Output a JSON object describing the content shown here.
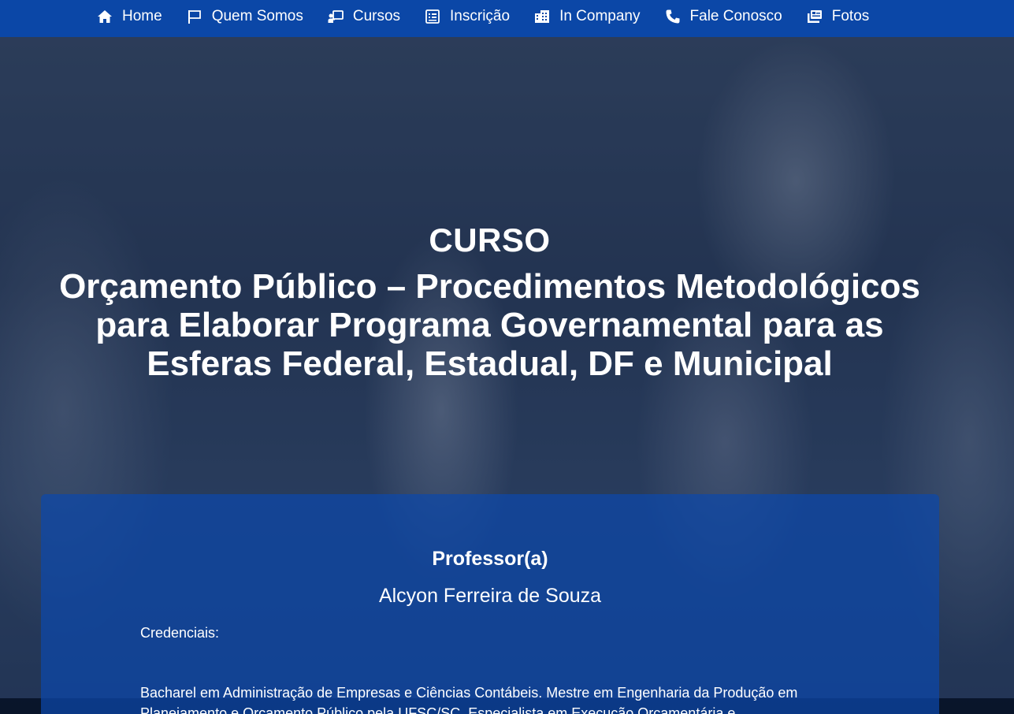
{
  "nav": {
    "items": [
      {
        "label": "Home",
        "icon": "home-icon"
      },
      {
        "label": "Quem Somos",
        "icon": "flag-icon"
      },
      {
        "label": "Cursos",
        "icon": "teacher-board-icon"
      },
      {
        "label": "Inscrição",
        "icon": "form-list-icon"
      },
      {
        "label": "In Company",
        "icon": "building-icon"
      },
      {
        "label": "Fale Conosco",
        "icon": "phone-icon"
      },
      {
        "label": "Fotos",
        "icon": "photos-icon"
      }
    ]
  },
  "hero": {
    "heading": "CURSO",
    "title": "Orçamento Público – Procedimentos Metodológicos para Elaborar Programa Governamental para as Esferas Federal, Estadual, DF e Municipal"
  },
  "professor_card": {
    "heading": "Professor(a)",
    "name": "Alcyon Ferreira de Souza",
    "credentials_label": "Credenciais:",
    "bio": "Bacharel em Administração de Empresas e Ciências Contábeis. Mestre em Engenharia da Produção em Planejamento e Orçamento Público pela UFSC/SC. Especialista em Execução Orçamentária e"
  },
  "colors": {
    "nav_background": "#0b47a7",
    "card_background": "#0d48aa",
    "text": "#ffffff"
  }
}
